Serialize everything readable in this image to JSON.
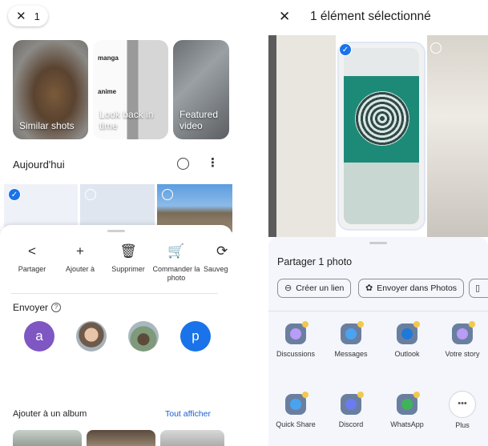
{
  "left": {
    "selection_count": "1",
    "cards": [
      {
        "label": "Similar shots"
      },
      {
        "label": "Look back in time",
        "tag_top": "manga",
        "tag_mid": "anime"
      },
      {
        "label": "Featured video"
      }
    ],
    "section_title": "Aujourd'hui",
    "actions": [
      {
        "label": "Partager",
        "icon": "share-icon"
      },
      {
        "label": "Ajouter à",
        "icon": "plus-icon"
      },
      {
        "label": "Supprimer",
        "icon": "trash-icon"
      },
      {
        "label": "Commander la photo",
        "icon": "cart-icon"
      },
      {
        "label": "Sauveg",
        "icon": "backup-icon"
      }
    ],
    "send_title": "Envoyer",
    "contacts": [
      {
        "initial": "a"
      },
      {
        "initial": ""
      },
      {
        "initial": ""
      },
      {
        "initial": "p"
      }
    ],
    "album_title": "Ajouter à un album",
    "album_link": "Tout afficher"
  },
  "right": {
    "title": "1 élément sélectionné",
    "share_title": "Partager 1 photo",
    "chips": [
      {
        "label": "Créer un lien",
        "icon": "link-icon"
      },
      {
        "label": "Envoyer dans Photos",
        "icon": "photos-icon"
      }
    ],
    "apps": [
      {
        "label": "Discussions"
      },
      {
        "label": "Messages"
      },
      {
        "label": "Outlook"
      },
      {
        "label": "Votre story"
      },
      {
        "label": "Quick Share"
      },
      {
        "label": "Discord"
      },
      {
        "label": "WhatsApp"
      },
      {
        "label": "Plus"
      }
    ]
  },
  "colors": {
    "accent": "#1a73e8",
    "link": "#1a5fd0",
    "avatar_a": "#7e57c2",
    "avatar_p": "#1a73e8",
    "sheet_bg": "#f4f6fb"
  }
}
